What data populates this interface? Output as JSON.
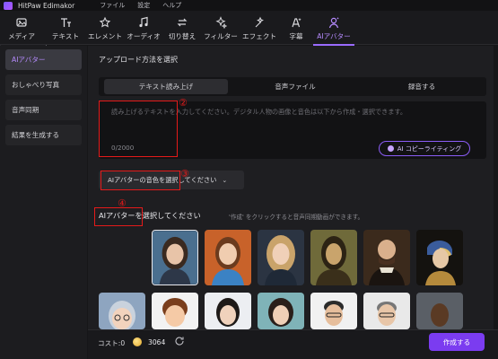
{
  "app": {
    "title": "HitPaw Edimakor"
  },
  "menubar": {
    "items": [
      "ファイル",
      "設定",
      "ヘルプ"
    ]
  },
  "toolbar": {
    "items": [
      {
        "label": "メディア",
        "icon": "media-icon"
      },
      {
        "label": "テキスト",
        "icon": "text-icon"
      },
      {
        "label": "エレメント",
        "icon": "element-icon"
      },
      {
        "label": "オーディオ",
        "icon": "audio-icon"
      },
      {
        "label": "切り替え",
        "icon": "transition-icon"
      },
      {
        "label": "フィルター",
        "icon": "filter-icon"
      },
      {
        "label": "エフェクト",
        "icon": "effect-icon"
      },
      {
        "label": "字幕",
        "icon": "subtitle-icon"
      },
      {
        "label": "AIアバター",
        "icon": "ai-avatar-icon",
        "active": true
      }
    ]
  },
  "sidebar": {
    "items": [
      {
        "label": "AIアバター",
        "active": true
      },
      {
        "label": "おしゃべり写真"
      },
      {
        "label": "音声同期"
      },
      {
        "label": "結果を生成する"
      }
    ]
  },
  "upload": {
    "title": "アップロード方法を選択",
    "tabs": [
      {
        "label": "テキスト読み上げ",
        "active": true
      },
      {
        "label": "音声ファイル"
      },
      {
        "label": "録音する"
      }
    ],
    "placeholder": "読み上げるテキストを入力してください。デジタル人物の画像と音色は以下から作成・選択できます。",
    "char_count": "0/2000",
    "ai_copy_button": "AI コピーライティング"
  },
  "voice_select": {
    "value": "AIアバターの音色を選択してください"
  },
  "avatars": {
    "title": "AIアバターを選択してください",
    "hint": "'作成' をクリックすると音声同期動画ができます。"
  },
  "annotations": [
    "②",
    "③",
    "④"
  ],
  "bottom": {
    "cost_label": "コスト:0",
    "coin_value": "3064",
    "create_button": "作成する"
  },
  "colors": {
    "accent": "#7b3cf0",
    "annotation": "#e51a1a",
    "background": "#161618"
  }
}
